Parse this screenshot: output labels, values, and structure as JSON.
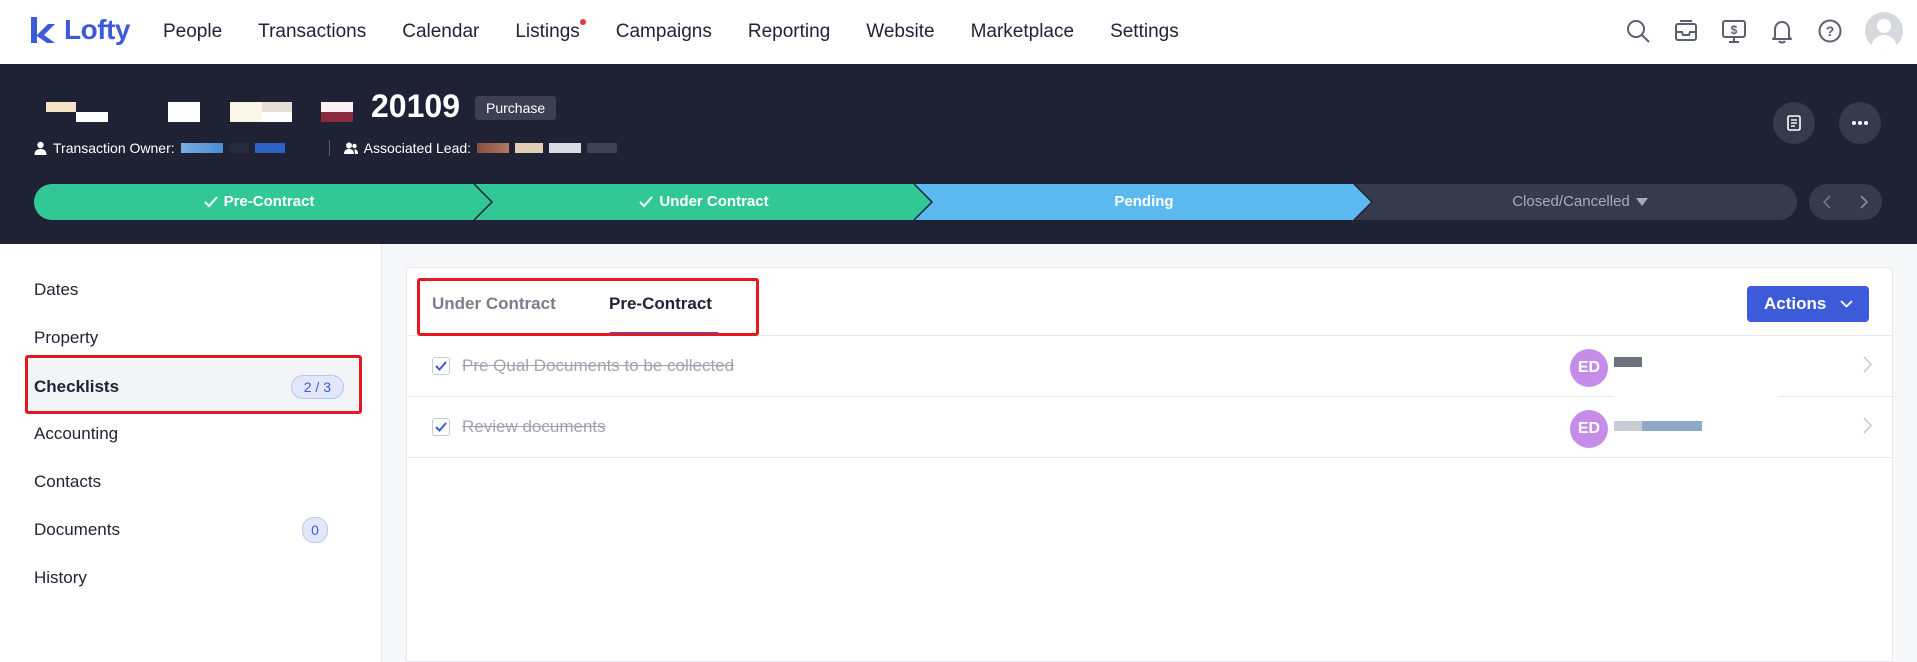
{
  "app": {
    "brand": "Lofty",
    "accent": "#3d5ad8"
  },
  "nav": {
    "items": [
      {
        "label": "People"
      },
      {
        "label": "Transactions"
      },
      {
        "label": "Calendar"
      },
      {
        "label": "Listings",
        "notification_dot": true
      },
      {
        "label": "Campaigns"
      },
      {
        "label": "Reporting"
      },
      {
        "label": "Website"
      },
      {
        "label": "Marketplace"
      },
      {
        "label": "Settings"
      }
    ],
    "icons": [
      "search-icon",
      "inbox-icon",
      "dollar-monitor-icon",
      "bell-icon",
      "help-icon",
      "avatar"
    ]
  },
  "transaction": {
    "id": "20109",
    "type_badge": "Purchase",
    "owner_label": "Transaction Owner:",
    "lead_label": "Associated Lead:"
  },
  "progress": {
    "stages": [
      {
        "label": "Pre-Contract",
        "status": "done",
        "color": "#32c896"
      },
      {
        "label": "Under Contract",
        "status": "done",
        "color": "#32c896"
      },
      {
        "label": "Pending",
        "status": "current",
        "color": "#5cb9ef"
      },
      {
        "label": "Closed/Cancelled",
        "status": "upcoming",
        "color": "#363a4d"
      }
    ]
  },
  "sidebar": {
    "items": [
      {
        "label": "Dates"
      },
      {
        "label": "Property"
      },
      {
        "label": "Checklists",
        "count": "2 / 3",
        "active": true
      },
      {
        "label": "Accounting"
      },
      {
        "label": "Contacts"
      },
      {
        "label": "Documents",
        "count": "0"
      },
      {
        "label": "History"
      }
    ]
  },
  "checklist": {
    "tabs": [
      {
        "label": "Under Contract"
      },
      {
        "label": "Pre-Contract",
        "active": true
      }
    ],
    "actions_label": "Actions",
    "tasks": [
      {
        "text": "Pre Qual Documents to be collected",
        "done": true,
        "assignee_initials": "ED"
      },
      {
        "text": "Review documents",
        "done": true,
        "assignee_initials": "ED"
      }
    ]
  }
}
